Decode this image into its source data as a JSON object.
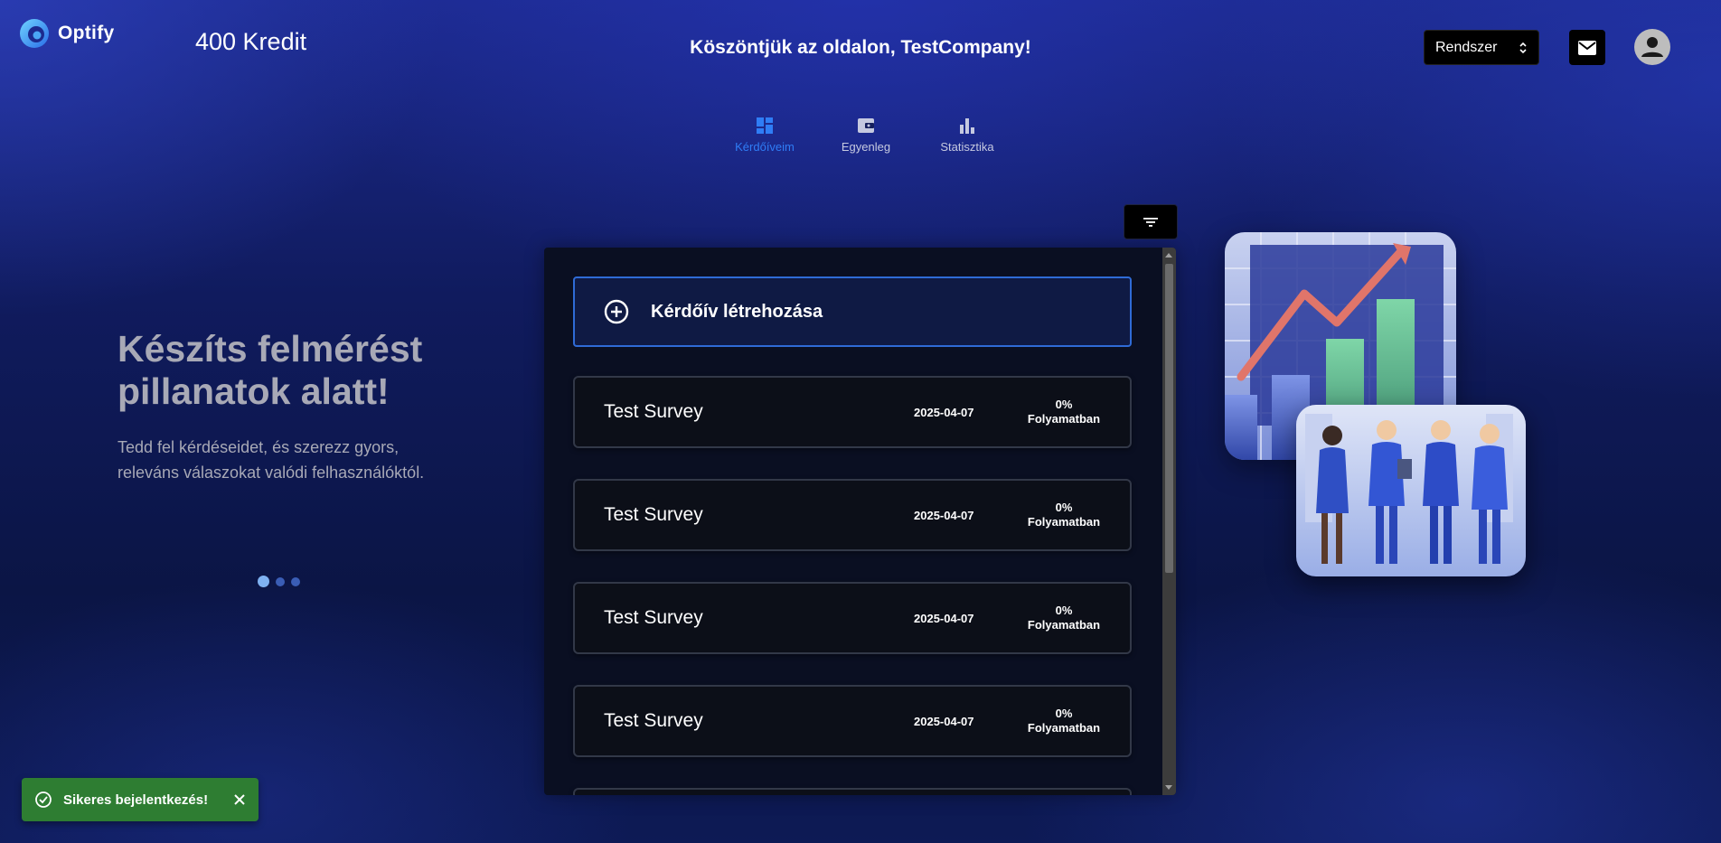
{
  "header": {
    "logo_text": "Optify",
    "credits": "400 Kredit",
    "welcome": "Köszöntjük az oldalon, TestCompany!",
    "system_select_value": "Rendszer"
  },
  "nav": {
    "tabs": [
      {
        "label": "Kérdőíveim",
        "icon": "dashboard-icon",
        "active": true
      },
      {
        "label": "Egyenleg",
        "icon": "wallet-icon",
        "active": false
      },
      {
        "label": "Statisztika",
        "icon": "bar-chart-icon",
        "active": false
      }
    ]
  },
  "hero": {
    "title": "Készíts felmérést pillanatok alatt!",
    "subtitle": "Tedd fel kérdéseidet, és szerezz gyors, releváns válaszokat valódi felhasználóktól.",
    "carousel_pages": 3,
    "carousel_active": 1
  },
  "surveys": {
    "create_label": "Kérdőív létrehozása",
    "items": [
      {
        "title": "Test Survey",
        "date": "2025-04-07",
        "progress": "0%",
        "status": "Folyamatban"
      },
      {
        "title": "Test Survey",
        "date": "2025-04-07",
        "progress": "0%",
        "status": "Folyamatban"
      },
      {
        "title": "Test Survey",
        "date": "2025-04-07",
        "progress": "0%",
        "status": "Folyamatban"
      },
      {
        "title": "Test Survey",
        "date": "2025-04-07",
        "progress": "0%",
        "status": "Folyamatban"
      },
      {
        "title": "",
        "date": "",
        "progress": "",
        "status": ""
      }
    ]
  },
  "toast": {
    "message": "Sikeres bejelentkezés!",
    "color": "#2e7d32"
  },
  "colors": {
    "accent": "#2f7df6",
    "background": "#101b5e"
  }
}
